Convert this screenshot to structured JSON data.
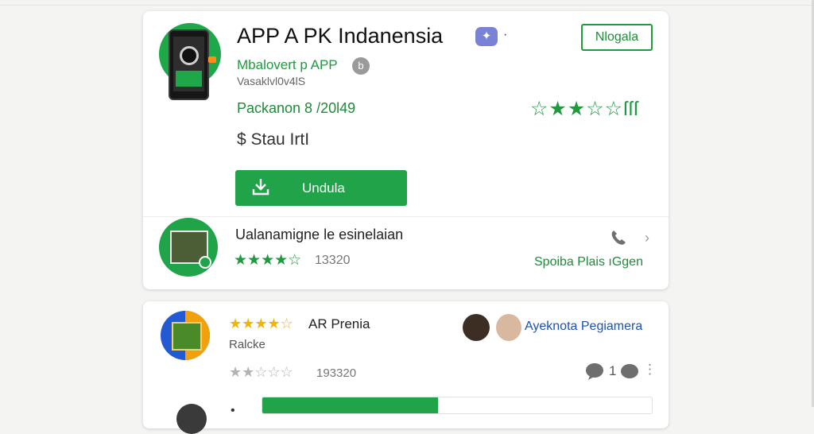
{
  "app": {
    "title": "APP A PK Indanensia",
    "developer": "Mbalovert p APP",
    "version": "Vasaklvl0v4lS",
    "package": "Packanon 8 /20l49",
    "price": "$ Stau IrtI",
    "header_button": "Nlogala",
    "download_label": "Undula",
    "rating_stars": "☆★★☆☆",
    "rating_suffix": "ſſſ",
    "icons": {
      "app": "app-phone-icon",
      "verified": "verified-badge-icon",
      "developer_badge": "info-badge-icon",
      "download": "download-icon"
    }
  },
  "related": {
    "title": "Ualanamigne le esinelaian",
    "stars": "★★★★☆",
    "count": "13320",
    "link": "Spoiba Plais ıGgen",
    "icons": {
      "call": "phone-icon",
      "next": "chevron-right-icon"
    }
  },
  "review": {
    "stars": "★★★★☆",
    "title": "AR Prenia",
    "subtitle": "Ralcke",
    "low_stars": "★★☆☆☆",
    "count": "193320",
    "link": "Ayeknota Pegiamera",
    "comment_count": "1",
    "progress": 0.45
  },
  "colors": {
    "accent": "#21a34a",
    "link_blue": "#1a52b5",
    "star_gold": "#f2b400"
  }
}
